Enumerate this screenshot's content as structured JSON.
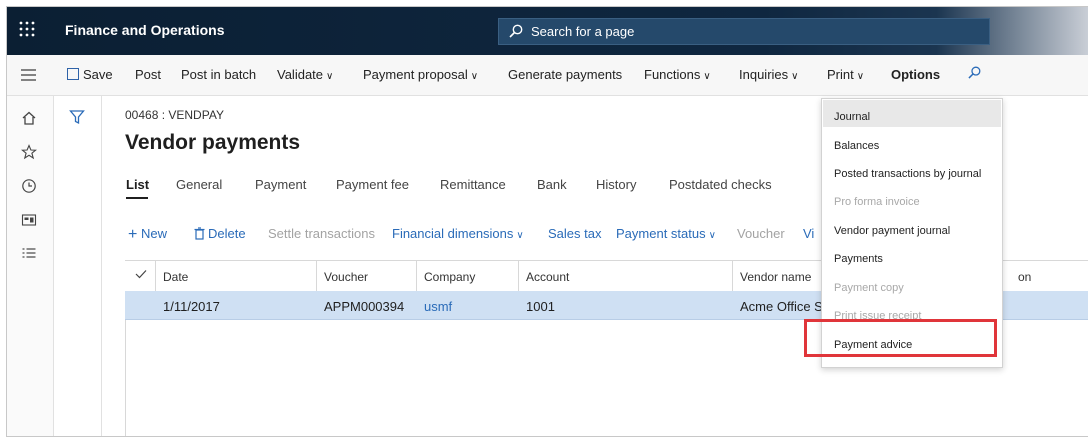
{
  "header": {
    "app_title": "Finance and Operations",
    "search_placeholder": "Search for a page"
  },
  "actions": {
    "save": "Save",
    "post": "Post",
    "post_in_batch": "Post in batch",
    "validate": "Validate",
    "payment_proposal": "Payment proposal",
    "generate_payments": "Generate payments",
    "functions": "Functions",
    "inquiries": "Inquiries",
    "print": "Print",
    "options": "Options"
  },
  "page": {
    "caption": "00468 : VENDPAY",
    "title": "Vendor payments"
  },
  "tabs": [
    "List",
    "General",
    "Payment",
    "Payment fee",
    "Remittance",
    "Bank",
    "History",
    "Postdated checks"
  ],
  "subtoolbar": {
    "new": "New",
    "delete": "Delete",
    "settle": "Settle transactions",
    "financial_dimensions": "Financial dimensions",
    "sales_tax": "Sales tax",
    "payment_status": "Payment status",
    "voucher": "Voucher",
    "truncated": "Vi"
  },
  "grid": {
    "columns": [
      "Date",
      "Voucher",
      "Company",
      "Account",
      "Vendor name",
      "on"
    ],
    "rows": [
      {
        "date": "1/11/2017",
        "voucher": "APPM000394",
        "company": "usmf",
        "account": "1001",
        "vendor_name": "Acme Office S"
      }
    ]
  },
  "print_menu": {
    "items": [
      {
        "label": "Journal",
        "enabled": true
      },
      {
        "label": "Balances",
        "enabled": true
      },
      {
        "label": "Posted transactions by journal",
        "enabled": true
      },
      {
        "label": "Pro forma invoice",
        "enabled": false
      },
      {
        "label": "Vendor payment journal",
        "enabled": true
      },
      {
        "label": "Payments",
        "enabled": true
      },
      {
        "label": "Payment copy",
        "enabled": false
      },
      {
        "label": "Print issue receipt",
        "enabled": false
      },
      {
        "label": "Payment advice",
        "enabled": true
      }
    ]
  },
  "colors": {
    "topbar": "#0f2740",
    "link": "#2a6bb8",
    "selected_row": "#cfe0f3",
    "highlight_box": "#e0353a"
  },
  "icons": [
    "waffle-icon",
    "search-icon",
    "hamburger-icon",
    "save-icon",
    "home-icon",
    "star-icon",
    "clock-icon",
    "workspace-icon",
    "list-icon",
    "filter-icon",
    "plus-icon",
    "trash-icon",
    "chevron-down-icon",
    "checkmark-icon"
  ]
}
